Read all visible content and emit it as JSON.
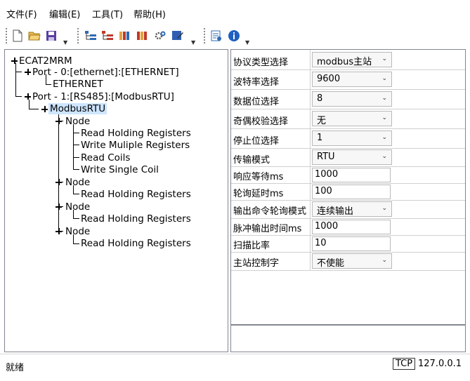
{
  "menu": {
    "items": [
      "文件(F)",
      "编辑(E)",
      "工具(T)",
      "帮助(H)"
    ]
  },
  "toolbar": {
    "icons": [
      "new-file-icon",
      "open-folder-icon",
      "save-icon",
      "add-port-icon",
      "add-node-icon",
      "download-config-icon",
      "upload-config-icon",
      "settings-gear-icon",
      "edit-icon",
      "device-info-icon",
      "about-info-icon"
    ]
  },
  "tree": {
    "root": "ECAT2MRM",
    "port0": "Port - 0:[ethernet]:[ETHERNET]",
    "port0_child": "ETHERNET",
    "port1": "Port - 1:[RS485]:[ModbusRTU]",
    "protocol": "ModbusRTU",
    "node_label": "Node",
    "node1_items": [
      "Read Holding Registers",
      "Write Muliple Registers",
      "Read Coils",
      "Write Single Coil"
    ],
    "node2_items": [
      "Read Holding Registers"
    ],
    "node3_items": [
      "Read Holding Registers"
    ],
    "node4_items": [
      "Read Holding Registers"
    ]
  },
  "properties": [
    {
      "label": "协议类型选择",
      "value": "modbus主站",
      "kind": "combo"
    },
    {
      "label": "波特率选择",
      "value": "9600",
      "kind": "combo"
    },
    {
      "label": "数据位选择",
      "value": "8",
      "kind": "combo"
    },
    {
      "label": "奇偶校验选择",
      "value": "无",
      "kind": "combo"
    },
    {
      "label": "停止位选择",
      "value": "1",
      "kind": "combo"
    },
    {
      "label": "传输模式",
      "value": "RTU",
      "kind": "combo"
    },
    {
      "label": "响应等待ms",
      "value": "1000",
      "kind": "text"
    },
    {
      "label": "轮询延时ms",
      "value": "100",
      "kind": "text"
    },
    {
      "label": "输出命令轮询模式",
      "value": "连续输出",
      "kind": "combo"
    },
    {
      "label": "脉冲输出时间ms",
      "value": "1000",
      "kind": "text"
    },
    {
      "label": "扫描比率",
      "value": "10",
      "kind": "text"
    },
    {
      "label": "主站控制字",
      "value": "不使能",
      "kind": "combo"
    }
  ],
  "status": {
    "text": "就绪",
    "conn_type": "TCP",
    "address": "127.0.0.1"
  }
}
